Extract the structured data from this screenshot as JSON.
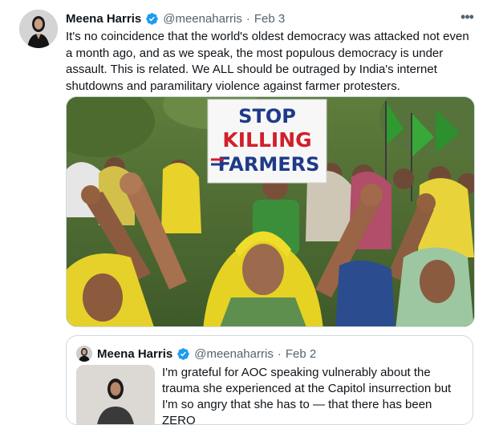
{
  "tweet": {
    "author_name": "Meena Harris",
    "handle": "@meenaharris",
    "separator": "·",
    "date": "Feb 3",
    "more_label": "•••",
    "text": "It's no coincidence that the world's oldest democracy was attacked not even a month ago, and as we speak, the most populous democracy is under assault. This is related. We ALL should be outraged by India's internet shutdowns and paramilitary violence against farmer protesters.",
    "media": {
      "sign_line1": "STOP",
      "sign_line2": "KILLING",
      "sign_line3": "FARMERS"
    }
  },
  "quoted": {
    "author_name": "Meena Harris",
    "handle": "@meenaharris",
    "separator": "·",
    "date": "Feb 2",
    "text": "I'm grateful for AOC speaking vulnerably about the trauma she experienced at the Capitol insurrection but I'm so angry that she has to — that there has been ZERO"
  },
  "colors": {
    "verified_badge": "#1d9bf0",
    "muted_text": "#536471",
    "border": "#cfd9de"
  },
  "icons": {
    "verified": "verified-badge-icon",
    "more": "more-options-icon"
  }
}
